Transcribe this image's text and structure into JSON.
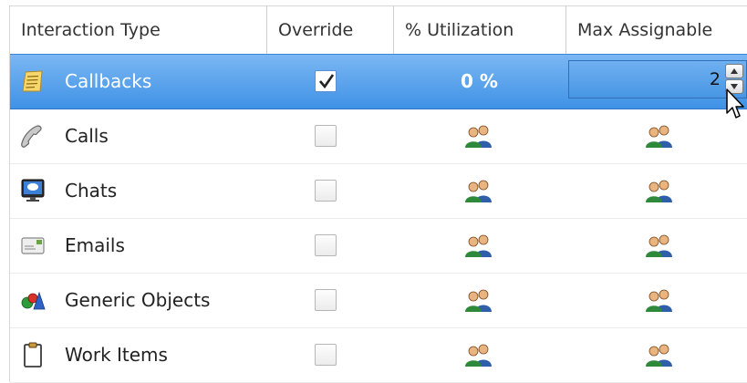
{
  "columns": [
    {
      "label": "Interaction Type"
    },
    {
      "label": "Override"
    },
    {
      "label": "% Utilization"
    },
    {
      "label": "Max Assignable"
    }
  ],
  "rows": [
    {
      "label": "Callbacks",
      "icon": "callback-note-icon",
      "override": true,
      "utilization": "0 %",
      "max_assignable": "2"
    },
    {
      "label": "Calls",
      "icon": "phone-handset-icon",
      "override": false,
      "utilization": "users-icon",
      "max_assignable": "users-icon"
    },
    {
      "label": "Chats",
      "icon": "chat-monitor-icon",
      "override": false,
      "utilization": "users-icon",
      "max_assignable": "users-icon"
    },
    {
      "label": "Emails",
      "icon": "email-envelope-icon",
      "override": false,
      "utilization": "users-icon",
      "max_assignable": "users-icon"
    },
    {
      "label": "Generic Objects",
      "icon": "generic-shapes-icon",
      "override": false,
      "utilization": "users-icon",
      "max_assignable": "users-icon"
    },
    {
      "label": "Work Items",
      "icon": "clipboard-icon",
      "override": false,
      "utilization": "users-icon",
      "max_assignable": "users-icon"
    }
  ],
  "colors": {
    "selection": "#3f92e6",
    "selection_light": "#7bb7f3",
    "text": "#222222"
  }
}
